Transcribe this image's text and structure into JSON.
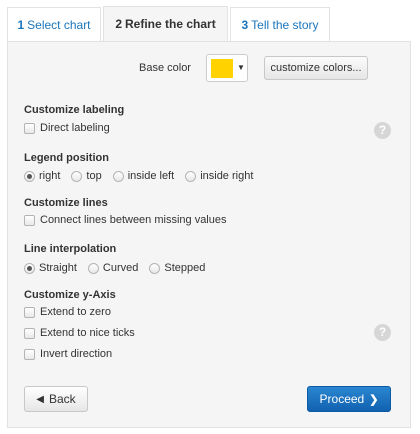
{
  "tabs": [
    {
      "number": "1",
      "label": "Select chart"
    },
    {
      "number": "2",
      "label": "Refine the chart"
    },
    {
      "number": "3",
      "label": "Tell the story"
    }
  ],
  "colors": {
    "base_swatch": "#ffd200",
    "accent": "#1a75bb"
  },
  "base_color": {
    "label": "Base color",
    "customize_label": "customize colors..."
  },
  "labeling": {
    "title": "Customize labeling",
    "direct_labeling": "Direct labeling"
  },
  "legend": {
    "title": "Legend position",
    "options": [
      "right",
      "top",
      "inside left",
      "inside right"
    ],
    "selected": "right"
  },
  "lines": {
    "title": "Customize lines",
    "connect_missing": "Connect lines between missing values"
  },
  "interpolation": {
    "title": "Line interpolation",
    "options": [
      "Straight",
      "Curved",
      "Stepped"
    ],
    "selected": "Straight"
  },
  "y_axis": {
    "title": "Customize y-Axis",
    "extend_zero": "Extend to zero",
    "nice_ticks": "Extend to nice ticks",
    "invert": "Invert direction"
  },
  "help_glyph": "?",
  "nav": {
    "back": "Back",
    "proceed": "Proceed"
  }
}
